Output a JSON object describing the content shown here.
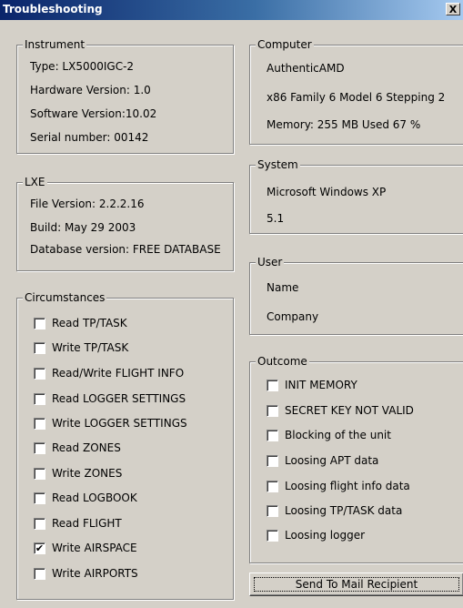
{
  "window": {
    "title": "Troubleshooting",
    "close_glyph": "X"
  },
  "instrument": {
    "legend": "Instrument",
    "lines": [
      "Type: LX5000IGC-2",
      "Hardware Version: 1.0",
      "Software Version:10.02",
      "Serial number: 00142"
    ]
  },
  "lxe": {
    "legend": "LXE",
    "lines": [
      "File Version: 2.2.2.16",
      "Build: May 29 2003",
      "Database version: FREE DATABASE"
    ]
  },
  "computer": {
    "legend": "Computer",
    "lines": [
      "AuthenticAMD",
      "x86 Family 6 Model 6 Stepping 2",
      "Memory: 255 MB Used 67 %"
    ]
  },
  "system": {
    "legend": "System",
    "lines": [
      "Microsoft Windows XP",
      "5.1"
    ]
  },
  "user": {
    "legend": "User",
    "lines": [
      "Name",
      "Company"
    ]
  },
  "circumstances": {
    "legend": "Circumstances",
    "items": [
      {
        "label": "Read TP/TASK",
        "checked": false
      },
      {
        "label": "Write TP/TASK",
        "checked": false
      },
      {
        "label": "Read/Write FLIGHT INFO",
        "checked": false
      },
      {
        "label": "Read LOGGER SETTINGS",
        "checked": false
      },
      {
        "label": "Write LOGGER SETTINGS",
        "checked": false
      },
      {
        "label": "Read ZONES",
        "checked": false
      },
      {
        "label": "Write ZONES",
        "checked": false
      },
      {
        "label": "Read LOGBOOK",
        "checked": false
      },
      {
        "label": "Read FLIGHT",
        "checked": false
      },
      {
        "label": "Write AIRSPACE",
        "checked": true
      },
      {
        "label": "Write AIRPORTS",
        "checked": false
      }
    ]
  },
  "outcome": {
    "legend": "Outcome",
    "items": [
      {
        "label": "INIT MEMORY",
        "checked": false
      },
      {
        "label": "SECRET KEY NOT VALID",
        "checked": false
      },
      {
        "label": "Blocking of the unit",
        "checked": false
      },
      {
        "label": "Loosing APT data",
        "checked": false
      },
      {
        "label": "Loosing flight info data",
        "checked": false
      },
      {
        "label": "Loosing TP/TASK data",
        "checked": false
      },
      {
        "label": "Loosing logger",
        "checked": false
      }
    ]
  },
  "actions": {
    "send_label": "Send To Mail Recipient"
  }
}
